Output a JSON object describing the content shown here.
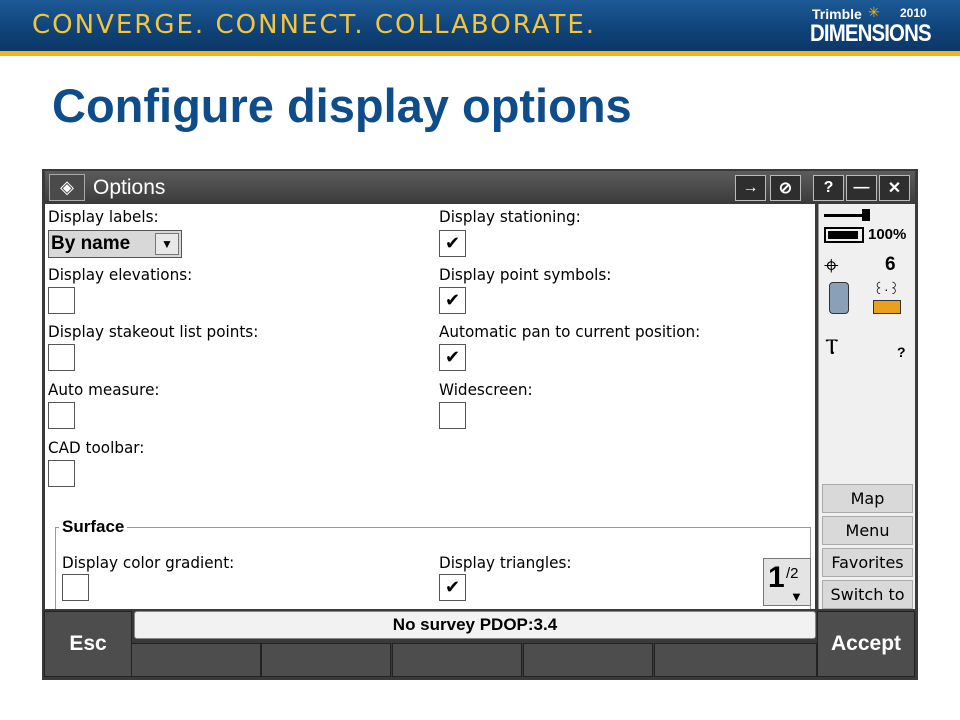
{
  "banner": {
    "tagline": "CONVERGE. CONNECT. COLLABORATE.",
    "logo_brand": "Trimble",
    "logo_year": "2010",
    "logo_name": "DIMENSIONS"
  },
  "slide_title": "Configure display options",
  "window": {
    "title": "Options",
    "buttons": [
      "→",
      "⊘",
      "?",
      "—",
      "✕"
    ]
  },
  "options": {
    "display_labels": {
      "label": "Display labels:",
      "value": "By name"
    },
    "display_elevations": {
      "label": "Display elevations:",
      "checked": false
    },
    "display_stakeout_list_points": {
      "label": "Display stakeout list points:",
      "checked": false
    },
    "auto_measure": {
      "label": "Auto measure:",
      "checked": false
    },
    "cad_toolbar": {
      "label": "CAD toolbar:",
      "checked": false
    },
    "display_stationing": {
      "label": "Display stationing:",
      "checked": true
    },
    "display_point_symbols": {
      "label": "Display point symbols:",
      "checked": true
    },
    "automatic_pan": {
      "label": "Automatic pan to current position:",
      "checked": true
    },
    "widescreen": {
      "label": "Widescreen:",
      "checked": false
    }
  },
  "surface": {
    "legend": "Surface",
    "display_color_gradient": {
      "label": "Display color gradient:",
      "checked": false
    },
    "display_triangles": {
      "label": "Display triangles:",
      "checked": true
    }
  },
  "pager": {
    "page": "1",
    "total": "/2"
  },
  "status_pane": {
    "battery": "100%",
    "satellites": "6",
    "unknown": "?",
    "buttons": [
      "Map",
      "Menu",
      "Favorites",
      "Switch to"
    ]
  },
  "status_bar": "No survey  PDOP:3.4",
  "softkeys": {
    "esc": "Esc",
    "accept": "Accept"
  },
  "check_glyph": "✔"
}
